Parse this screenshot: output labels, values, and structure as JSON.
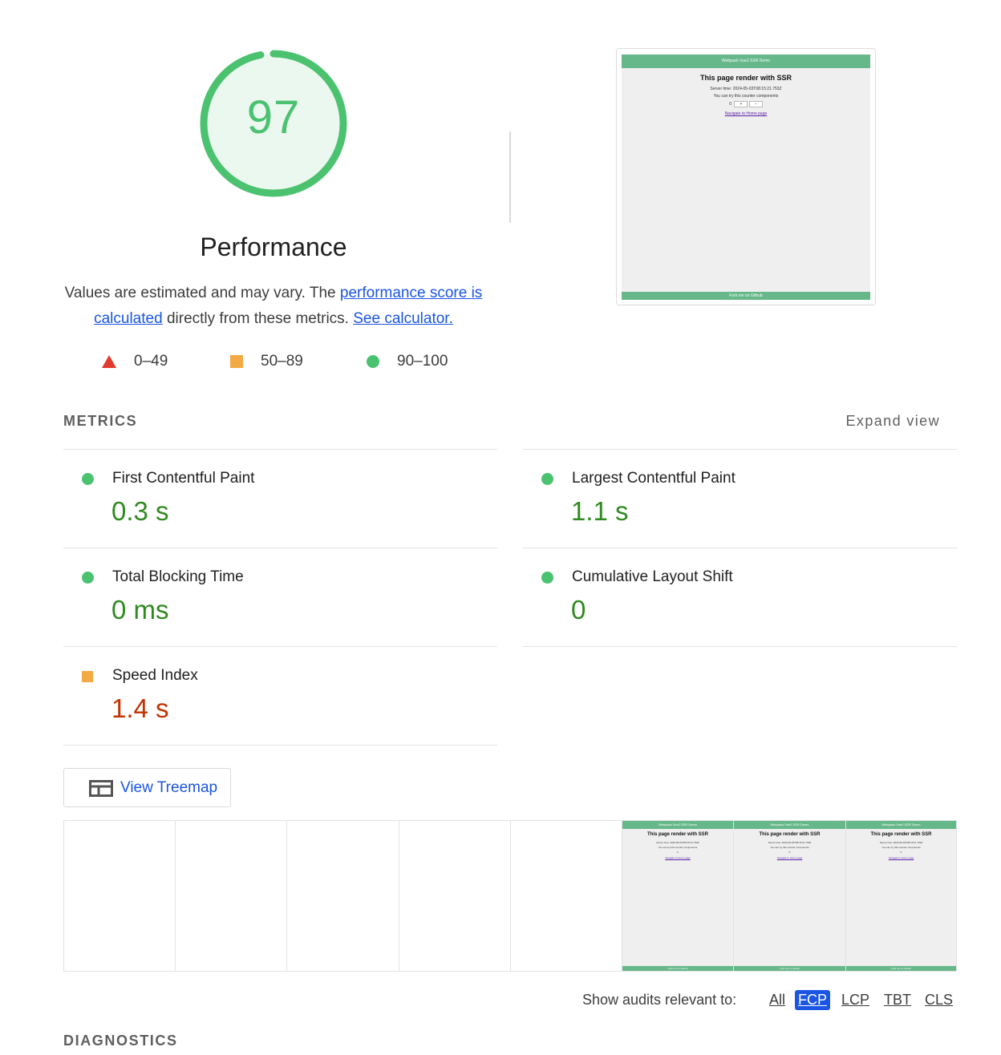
{
  "gauge": {
    "score": "97",
    "score_fraction": 0.97,
    "title": "Performance",
    "color": "#4bc26f"
  },
  "description": {
    "before": "Values are estimated and may vary. The ",
    "link1": "performance score is calculated",
    "middle": " directly from these metrics. ",
    "link2": "See calculator."
  },
  "scale": [
    {
      "range": "0–49",
      "shape": "triangle",
      "color": "#e33a2f"
    },
    {
      "range": "50–89",
      "shape": "square",
      "color": "#f3a944"
    },
    {
      "range": "90–100",
      "shape": "circle",
      "color": "#4bc26f"
    }
  ],
  "screenshot": {
    "header": "Webpack Vue2 SSR Demo",
    "heading": "This page render with SSR",
    "server_time": "Server time: 2024-05-03T08:15:21.753Z",
    "counter_hint": "You can try this counter components",
    "counter_value": "0",
    "plus": "+",
    "minus": "−",
    "navigate": "Navigate to Home page",
    "footer": "Fork me on Github"
  },
  "metrics": {
    "heading": "METRICS",
    "expand": "Expand view",
    "items": [
      {
        "label": "First Contentful Paint",
        "value": "0.3 s",
        "rating": "good"
      },
      {
        "label": "Largest Contentful Paint",
        "value": "1.1 s",
        "rating": "good"
      },
      {
        "label": "Total Blocking Time",
        "value": "0 ms",
        "rating": "good"
      },
      {
        "label": "Cumulative Layout Shift",
        "value": "0",
        "rating": "good"
      },
      {
        "label": "Speed Index",
        "value": "1.4 s",
        "rating": "average"
      }
    ]
  },
  "treemap": {
    "label": "View Treemap",
    "icon": "treemap-icon"
  },
  "audits": {
    "label": "Show audits relevant to:",
    "filters": [
      "All",
      "FCP",
      "LCP",
      "TBT",
      "CLS"
    ],
    "active": "FCP"
  },
  "diagnostics": {
    "heading": "DIAGNOSTICS"
  }
}
